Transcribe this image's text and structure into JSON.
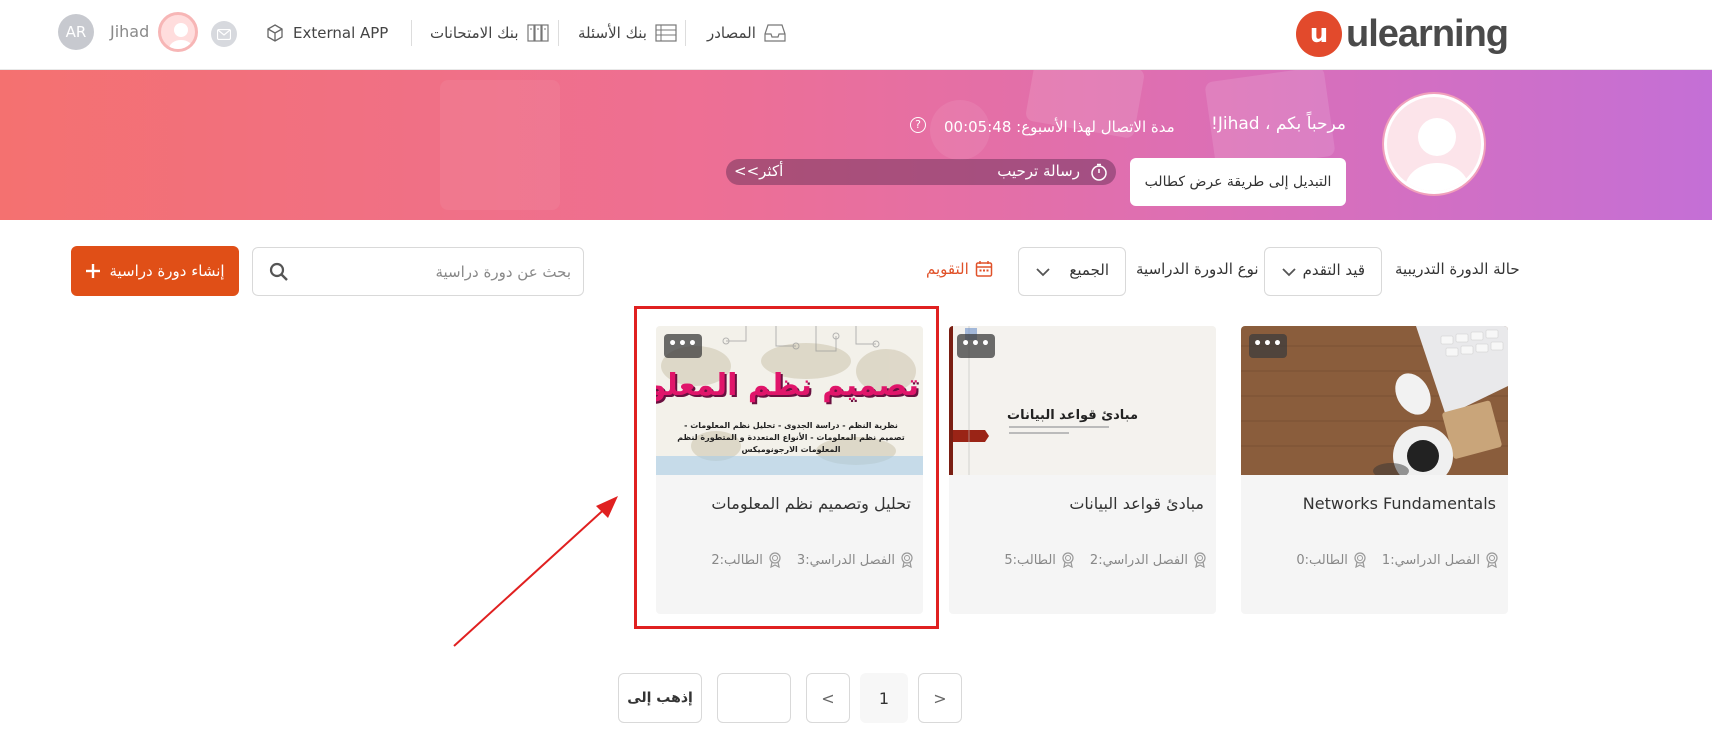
{
  "header": {
    "logo_text": "ulearning",
    "logo_mark": "u",
    "nav": {
      "resources": "المصادر",
      "question_bank": "بنك الأسئلة",
      "exam_bank": "بنك الامتحانات",
      "external_app": "External APP"
    },
    "user_name": "Jihad",
    "avatar_initials": "AR"
  },
  "banner": {
    "welcome": "مرحباً بكم ، Jihad!",
    "online_time_label": "مدة الاتصال لهذا الأسبوع: 00:05:48",
    "help_icon": "?",
    "message_title": "رسالة ترحيب",
    "more_link": "أكثر>>",
    "switch_button": "التبديل إلى طريقة عرض كطالب"
  },
  "filters": {
    "status_label": "حالة الدورة التدريبية",
    "status_value": "قيد التقدم",
    "type_label": "نوع الدورة الدراسية",
    "type_value": "الجميع",
    "calendar_label": "التقويم",
    "search_placeholder": "بحث عن دورة دراسية",
    "create_button": "إنشاء دورة دراسية"
  },
  "courses": [
    {
      "title": "Networks Fundamentals",
      "term": "الفصل الدراسي:1",
      "students": "الطالب:0",
      "more": "•••"
    },
    {
      "title": "مبادئ قواعد البيانات",
      "term": "الفصل الدراسي:2",
      "students": "الطالب:5",
      "more": "•••",
      "cover_text": "مبادئ قواعد البيانات"
    },
    {
      "title": "تحليل وتصميم نظم المعلومات",
      "term": "الفصل الدراسي:3",
      "students": "الطالب:2",
      "more": "•••",
      "cover_title": "تصميم نظم المعلومات",
      "cover_subtitle": "نظرية النظم - دراسة الجدوى - تحليل نظم المعلومات - تصميم نظم المعلومات - الأنواع المتعددة و المتطورة لنظم المعلومات الارجونوميكس"
    }
  ],
  "pagination": {
    "prev": "<",
    "current": "1",
    "next": ">",
    "goto_button": "إذهب إلى",
    "goto_value": ""
  },
  "colors": {
    "accent": "#e04f17",
    "highlight": "#e02020"
  }
}
